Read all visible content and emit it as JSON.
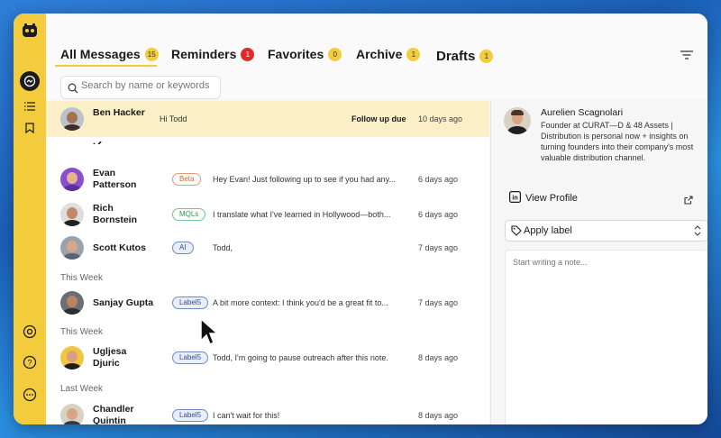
{
  "tabs": [
    {
      "label": "All Messages",
      "count": "15",
      "red": false
    },
    {
      "label": "Reminders",
      "count": "1",
      "red": true
    },
    {
      "label": "Favorites",
      "count": "0",
      "red": false
    },
    {
      "label": "Archive",
      "count": "1",
      "red": false
    },
    {
      "label": "Drafts",
      "count": "1",
      "red": false
    }
  ],
  "search": {
    "placeholder": "Search by name or keywords"
  },
  "sections": {
    "this_week_1": "This Week",
    "this_week_2": "This Week",
    "last_week": "Last Week"
  },
  "rows": [
    {
      "name": "Ben Hacker",
      "label": "",
      "message": "Hi Todd",
      "status": "Follow up due",
      "time": "10 days ago"
    },
    {
      "name": "Evan Patterson",
      "label": "Beta",
      "message": "Hey Evan! Just following up to see if you had any...",
      "status": "",
      "time": "6 days ago"
    },
    {
      "name": "Rich Bornstein",
      "label": "MQLs",
      "message": "I translate what I've learned in Hollywood—both...",
      "status": "",
      "time": "6 days ago"
    },
    {
      "name": "Scott Kutos",
      "label": "AI",
      "message": "Todd,",
      "status": "",
      "time": "7 days ago"
    },
    {
      "name": "Sanjay Gupta",
      "label": "Label5",
      "message": "A bit more context: I think you'd be a great fit to...",
      "status": "",
      "time": "7 days ago"
    },
    {
      "name": "Ugljesa Djuric",
      "label": "Label5",
      "message": "Todd, I'm going to pause outreach after this note.",
      "status": "",
      "time": "8 days ago"
    },
    {
      "name": "Chandler Quintin",
      "label": "Label5",
      "message": "I can't wait for this!",
      "status": "",
      "time": "8 days ago"
    }
  ],
  "profile": {
    "name": "Aurelien Scagnolari",
    "bio": "Founder at CURAT—D & 48 Assets | Distribution is personal now + insights on turning founders into their company's most valuable distribution channel.",
    "view_profile": "View Profile",
    "apply_label": "Apply label",
    "note_placeholder": "Start writing a note..."
  },
  "colors": {
    "accent": "#f3cc3e",
    "selected_row": "#faefc7",
    "badge_red": "#e02b2b"
  }
}
